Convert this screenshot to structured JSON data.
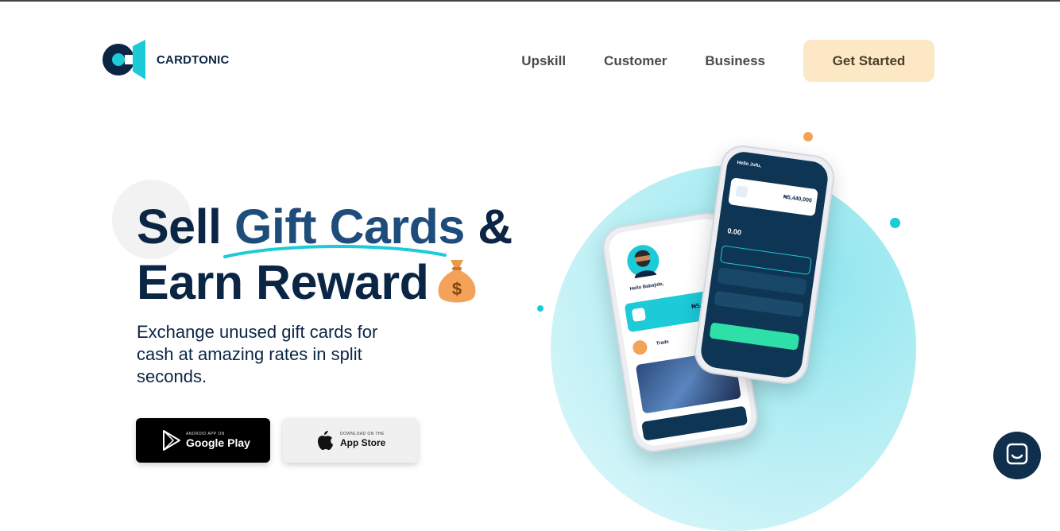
{
  "brand": {
    "name": "CARDTONIC"
  },
  "nav": {
    "links": [
      "Upskill",
      "Customer",
      "Business"
    ],
    "cta": "Get Started"
  },
  "hero": {
    "headline_1": "Sell ",
    "headline_accent": "Gift Cards",
    "headline_2": " &",
    "headline_3": "Earn Reward",
    "subtitle": "Exchange unused gift cards for cash at amazing rates in split seconds."
  },
  "stores": {
    "google": {
      "small": "ANDROID APP ON",
      "big": "Google Play"
    },
    "apple": {
      "small": "DOWNLOAD ON THE",
      "big": "App Store"
    }
  },
  "phone_back": {
    "greeting": "Hello Babajide,",
    "balance": "₦5,440,00",
    "trade_label": "Trade"
  },
  "phone_front": {
    "greeting": "Hello Jufu,",
    "balance": "₦5,440,000",
    "zero_balance": "0.00"
  },
  "colors": {
    "navy": "#0b2545",
    "accent_blue": "#1e4d7b",
    "teal": "#1ccad8",
    "cta_bg": "#fde8c6",
    "orange": "#f4a259"
  },
  "icons": [
    "cardtonic-logo-icon",
    "money-bag-icon",
    "google-play-icon",
    "apple-icon",
    "chat-icon"
  ]
}
